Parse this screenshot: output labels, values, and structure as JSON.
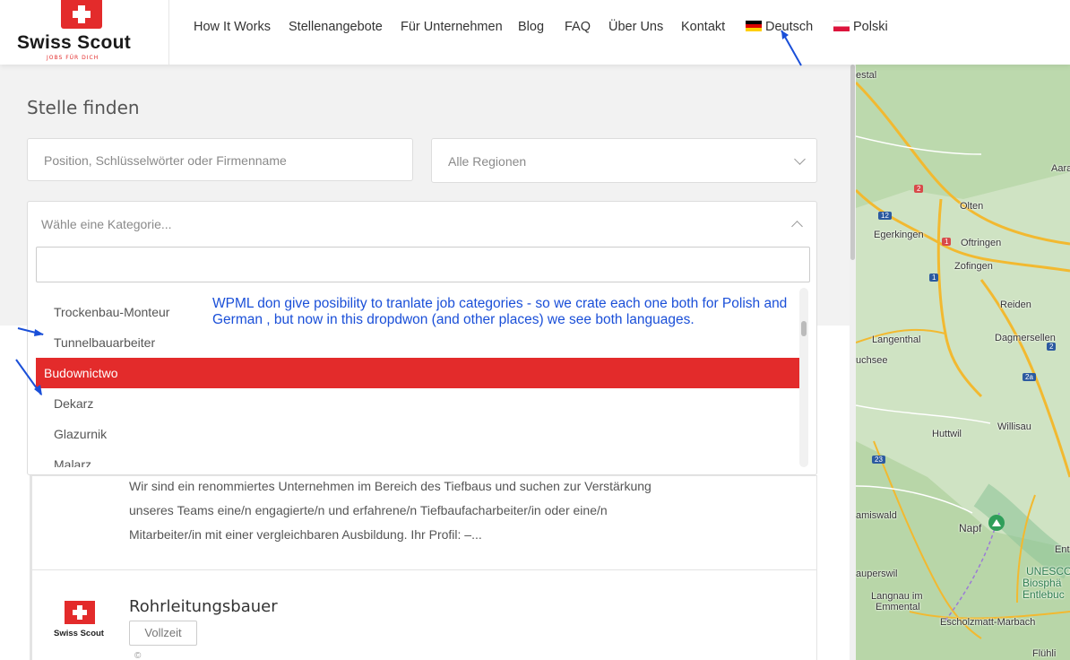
{
  "brand": {
    "name": "Swiss Scout",
    "tagline": "JOBS FÜR DICH"
  },
  "nav": {
    "items": [
      "How It Works",
      "Stellenangebote",
      "Für Unternehmen",
      "Blog",
      "FAQ",
      "Über Uns",
      "Kontakt"
    ],
    "lang_de": "Deutsch",
    "lang_pl": "Polski"
  },
  "search": {
    "title": "Stelle finden",
    "keyword_placeholder": "Position, Schlüsselwörter oder Firmenname",
    "region_value": "Alle Regionen",
    "category_placeholder": "Wähle eine Kategorie..."
  },
  "dropdown": {
    "items": [
      "Trockenbau-Monteur",
      "Tunnelbauarbeiter",
      "Budownictwo",
      "Dekarz",
      "Glazurnik",
      "Malarz"
    ],
    "highlighted": "Budownictwo"
  },
  "annotation": "WPML don give posibility to tranlate job categories - so we crate each one both for Polish and German , but now in this dropdwon (and other places) we see both languages.",
  "jobs": {
    "desc_lines": [
      "Wir sind ein renommiertes Unternehmen im Bereich des Tiefbaus und suchen zur Verstärkung",
      "unseres Teams eine/n engagierte/n und erfahrene/n Tiefbaufacharbeiter/in oder eine/n",
      "Mitarbeiter/in mit einer vergleichbaren Ausbildung. Ihr Profil: –..."
    ],
    "second_title": "Rohrleitungsbauer",
    "second_badge": "Vollzeit",
    "second_logo": "Swiss Scout",
    "second_meta": "©"
  },
  "map": {
    "labels": [
      "estal",
      "Aara",
      "Olten",
      "Egerkingen",
      "Oftringen",
      "Zofingen",
      "Reiden",
      "Langenthal",
      "Dagmersellen",
      "uchsee",
      "Huttwil",
      "Willisau",
      "amiswald",
      "Napf",
      "Ent",
      "auperswil",
      "Langnau im",
      "Emmental",
      "Escholzmatt-Marbach",
      "Flühli",
      "UNESCO",
      "Biosphä",
      "Entlebuc"
    ],
    "shields": [
      "2",
      "12",
      "1",
      "1",
      "2",
      "2a",
      "23"
    ]
  },
  "colors": {
    "accent": "#e32b2b",
    "annotation": "#1a4fd8"
  }
}
